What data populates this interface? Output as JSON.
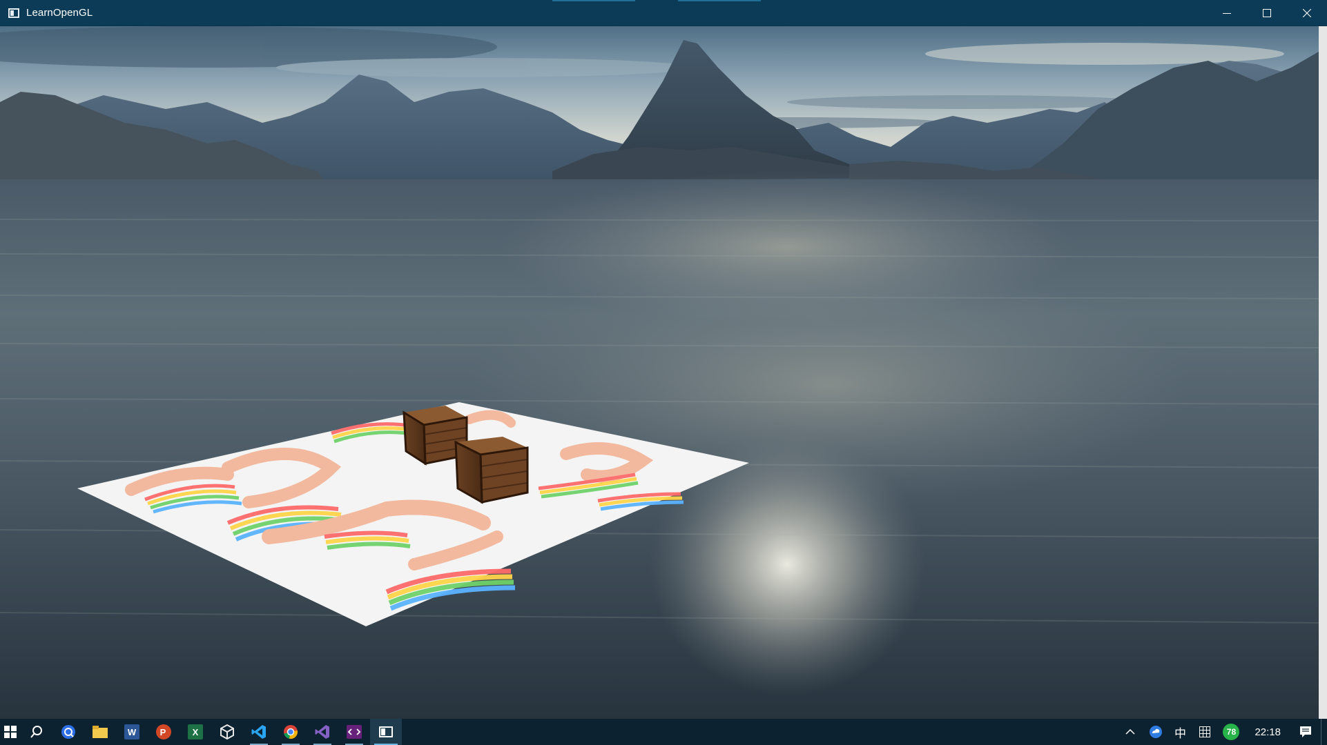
{
  "window": {
    "title": "LearnOpenGL",
    "controls": [
      "minimize",
      "maximize",
      "close"
    ]
  },
  "scene": {
    "description_icons": [
      "skybox-mountains",
      "water",
      "textured-floor-plane",
      "wooden-crate",
      "wooden-crate"
    ]
  },
  "taskbar": {
    "apps": [
      {
        "name": "start-button",
        "icon": "windows-logo-icon"
      },
      {
        "name": "search-button",
        "icon": "search-icon"
      },
      {
        "name": "app-browser-q",
        "icon": "q-browser-icon"
      },
      {
        "name": "app-file-explorer",
        "icon": "folder-icon"
      },
      {
        "name": "app-word",
        "icon": "word-icon",
        "letter": "W"
      },
      {
        "name": "app-powerpoint",
        "icon": "powerpoint-icon",
        "letter": "P"
      },
      {
        "name": "app-excel",
        "icon": "excel-icon",
        "letter": "X"
      },
      {
        "name": "app-unity",
        "icon": "unity-icon"
      },
      {
        "name": "app-vscode",
        "icon": "vscode-icon"
      },
      {
        "name": "app-chrome",
        "icon": "chrome-icon"
      },
      {
        "name": "app-visual-studio",
        "icon": "visual-studio-icon"
      },
      {
        "name": "app-vs-code-dev",
        "icon": "dev-tool-icon"
      },
      {
        "name": "app-learnopengl",
        "icon": "opengl-window-icon"
      }
    ],
    "tray": {
      "ime_label": "中",
      "badge_value": "78",
      "time": "22:18"
    },
    "colors": {
      "taskbar_bg": "#0d2230",
      "titlebar_bg": "#0c3b57",
      "accent": "#6bb7e8"
    }
  }
}
